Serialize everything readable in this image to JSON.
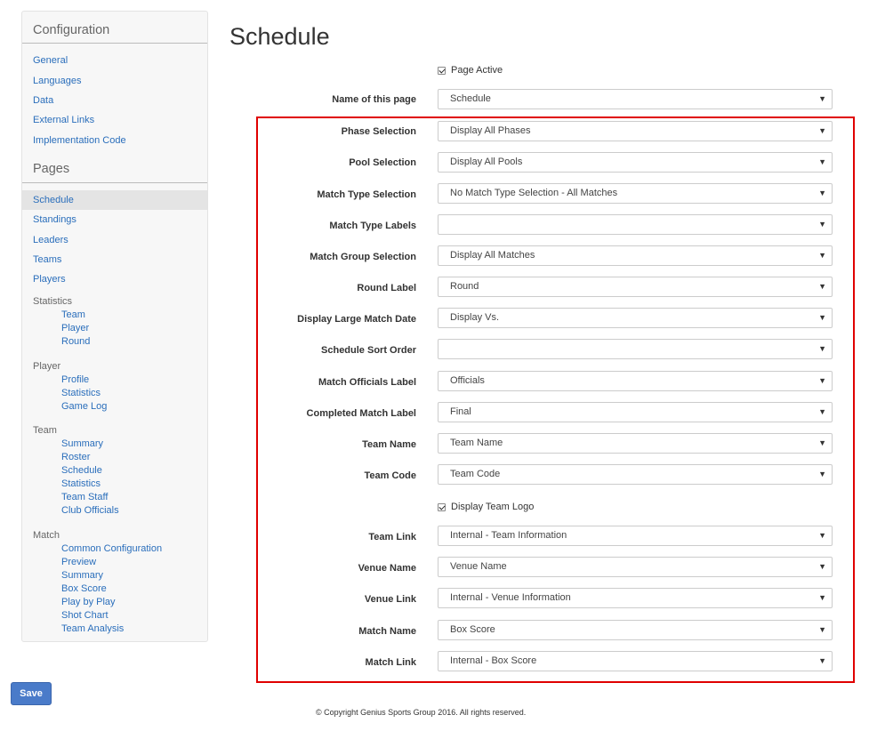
{
  "sidebar": {
    "configuration_heading": "Configuration",
    "configuration_links": [
      "General",
      "Languages",
      "Data",
      "External Links",
      "Implementation Code"
    ],
    "pages_heading": "Pages",
    "pages_links": [
      "Schedule",
      "Standings",
      "Leaders",
      "Teams",
      "Players"
    ],
    "statistics": {
      "label": "Statistics",
      "items": [
        "Team",
        "Player",
        "Round"
      ]
    },
    "player": {
      "label": "Player",
      "items": [
        "Profile",
        "Statistics",
        "Game Log"
      ]
    },
    "team": {
      "label": "Team",
      "items": [
        "Summary",
        "Roster",
        "Schedule",
        "Statistics",
        "Team Staff",
        "Club Officials"
      ]
    },
    "match": {
      "label": "Match",
      "items": [
        "Common Configuration",
        "Preview",
        "Summary",
        "Box Score",
        "Play by Play",
        "Shot Chart",
        "Team Analysis"
      ]
    }
  },
  "save_label": "Save",
  "page_title": "Schedule",
  "page_active_label": "Page Active",
  "page_name": {
    "label": "Name of this page",
    "value": "Schedule"
  },
  "fields": [
    {
      "label": "Phase Selection",
      "value": "Display All Phases"
    },
    {
      "label": "Pool Selection",
      "value": "Display All Pools"
    },
    {
      "label": "Match Type Selection",
      "value": "No Match Type Selection - All Matches"
    },
    {
      "label": "Match Type Labels",
      "value": ""
    },
    {
      "label": "Match Group Selection",
      "value": "Display All Matches"
    },
    {
      "label": "Round Label",
      "value": "Round"
    },
    {
      "label": "Display Large Match Date",
      "value": "Display Vs."
    },
    {
      "label": "Schedule Sort Order",
      "value": ""
    },
    {
      "label": "Match Officials Label",
      "value": "Officials"
    },
    {
      "label": "Completed Match Label",
      "value": "Final"
    },
    {
      "label": "Team Name",
      "value": "Team Name"
    },
    {
      "label": "Team Code",
      "value": "Team Code"
    }
  ],
  "display_team_logo_label": "Display Team Logo",
  "fields2": [
    {
      "label": "Team Link",
      "value": "Internal - Team Information"
    },
    {
      "label": "Venue Name",
      "value": "Venue Name"
    },
    {
      "label": "Venue Link",
      "value": "Internal - Venue Information"
    },
    {
      "label": "Match Name",
      "value": "Box Score"
    },
    {
      "label": "Match Link",
      "value": "Internal - Box Score"
    }
  ],
  "caret_glyph": "▼",
  "footer": "© Copyright Genius Sports Group 2016. All rights reserved.",
  "colors": {
    "link": "#2a6ebb",
    "highlight": "#e00000",
    "save_button": "#4a7bc9"
  }
}
